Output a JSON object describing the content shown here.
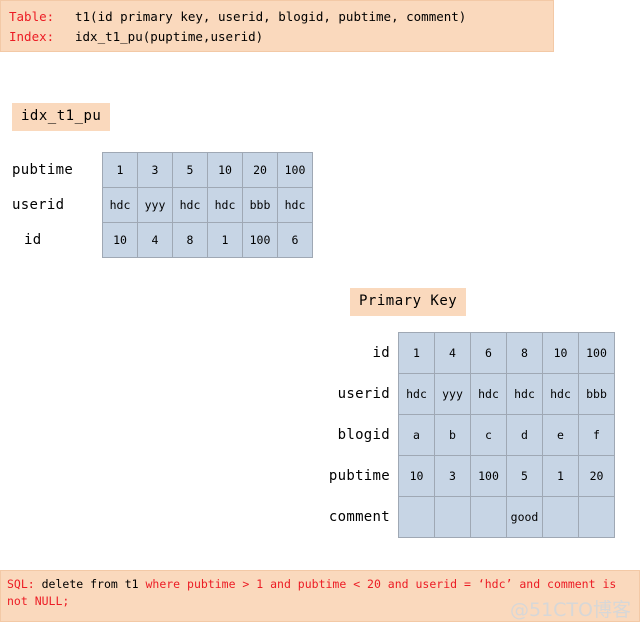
{
  "header": {
    "table_label": "Table:",
    "table_def": "t1(id primary key, userid, blogid, pubtime, comment)",
    "index_label": "Index:",
    "index_def": "idx_t1_pu(puptime,userid)"
  },
  "index_section": {
    "chip_label": "idx_t1_pu",
    "rows": [
      {
        "label": "pubtime",
        "cells": [
          "1",
          "3",
          "5",
          "10",
          "20",
          "100"
        ]
      },
      {
        "label": "userid",
        "cells": [
          "hdc",
          "yyy",
          "hdc",
          "hdc",
          "bbb",
          "hdc"
        ]
      },
      {
        "label": "id",
        "cells": [
          "10",
          "4",
          "8",
          "1",
          "100",
          "6"
        ]
      }
    ]
  },
  "primary_key_section": {
    "chip_label": "Primary Key",
    "rows": [
      {
        "label": "id",
        "cells": [
          "1",
          "4",
          "6",
          "8",
          "10",
          "100"
        ]
      },
      {
        "label": "userid",
        "cells": [
          "hdc",
          "yyy",
          "hdc",
          "hdc",
          "hdc",
          "bbb"
        ]
      },
      {
        "label": "blogid",
        "cells": [
          "a",
          "b",
          "c",
          "d",
          "e",
          "f"
        ]
      },
      {
        "label": "pubtime",
        "cells": [
          "10",
          "3",
          "100",
          "5",
          "1",
          "20"
        ]
      },
      {
        "label": "comment",
        "cells": [
          "",
          "",
          "",
          "good",
          "",
          ""
        ]
      }
    ]
  },
  "footer": {
    "sql_prefix": "SQL:",
    "sql_plain": " delete from t1 ",
    "sql_red_line1": "where pubtime > 1 and pubtime < 20 and userid =  ‘hdc’ and comment is",
    "sql_red_line2": "not NULL;",
    "watermark": "@51CTO博客"
  },
  "colors": {
    "banner_bg": "#fad9bd",
    "keyword_red": "#ec1c24",
    "cell_bg": "#c7d5e5",
    "cell_border": "#9fa8b4",
    "watermark": "#d7d7d7"
  }
}
